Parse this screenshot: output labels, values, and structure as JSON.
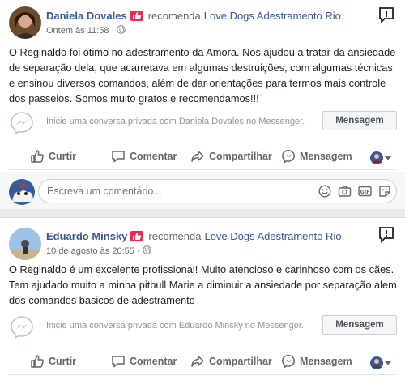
{
  "posts": [
    {
      "author": "Daniela Dovales",
      "recommends": "recomenda",
      "page": "Love Dogs Adestramento Rio.",
      "time": "Ontem às 11:58",
      "dot": "·",
      "body": "O Reginaldo foi ótimo no adestramento da Amora. Nos ajudou a tratar da ansiedade de separação dela, que acarretava em algumas destruições, com algumas técnicas e ensinou diversos comandos, além de dar orientações para termos mais controle dos passeios. Somos muito gratos e recomendamos!!!",
      "messenger_prompt": "Inicie uma conversa privada com Daniela Dovales no Messenger.",
      "message_button": "Mensagem"
    },
    {
      "author": "Eduardo Minsky",
      "recommends": "recomenda",
      "page": "Love Dogs Adestramento Rio.",
      "time": "10 de agosto às 20:55",
      "dot": "·",
      "body": "O Reginaldo é um excelente profissional! Muito atencioso e carinhoso com os cães. Tem ajudado muito a minha pitbull Marie a diminuir a ansiedade por separação alem dos comandos basicos de adestramento",
      "messenger_prompt": "Inicie uma conversa privada com Eduardo Minsky no Messenger.",
      "message_button": "Mensagem"
    }
  ],
  "actions": {
    "like": "Curtir",
    "comment": "Comentar",
    "share": "Compartilhar",
    "message": "Mensagem"
  },
  "comment_box": {
    "placeholder": "Escreva um comentário...",
    "tools": [
      "emoji-icon",
      "camera-icon",
      "gif-icon",
      "sticker-icon"
    ]
  },
  "colors": {
    "link": "#365899",
    "badge": "#f02849",
    "muted": "#606770",
    "background": "#e9ebee"
  }
}
